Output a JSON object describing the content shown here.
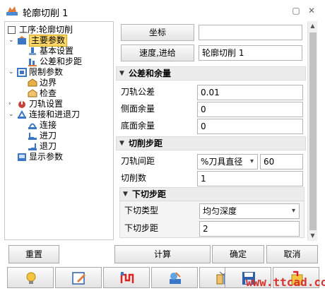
{
  "window": {
    "title": "轮廓切削 1"
  },
  "tree": {
    "items": [
      {
        "label": "工序:轮廓切削"
      },
      {
        "label": "主要参数"
      },
      {
        "label": "基本设置"
      },
      {
        "label": "公差和步距"
      },
      {
        "label": "限制参数"
      },
      {
        "label": "边界"
      },
      {
        "label": "检查"
      },
      {
        "label": "刀轨设置"
      },
      {
        "label": "连接和进退刀"
      },
      {
        "label": "连接"
      },
      {
        "label": "进刀"
      },
      {
        "label": "退刀"
      },
      {
        "label": "显示参数"
      }
    ]
  },
  "panel": {
    "coord_button": "坐标",
    "coord_value": "",
    "feed_button": "速度,进给",
    "feed_value": "轮廓切削 1",
    "tolerance_section": {
      "title": "公差和余量",
      "fields": [
        {
          "label": "刀轨公差",
          "value": "0.01"
        },
        {
          "label": "侧面余量",
          "value": "0"
        },
        {
          "label": "底面余量",
          "value": "0"
        }
      ]
    },
    "stepover_section": {
      "title": "切削步距",
      "spacing_label": "刀轨间距",
      "spacing_mode": "%刀具直径",
      "spacing_value": "60",
      "count_label": "切削数",
      "count_value": "1"
    },
    "stepdown_section": {
      "title": "下切步距",
      "type_label": "下切类型",
      "type_value": "均匀深度",
      "step_label": "下切步距",
      "step_value": "2"
    }
  },
  "buttons": {
    "reset": "重置",
    "calculate": "计算",
    "ok": "确定",
    "cancel": "取消"
  },
  "watermark": "www.ttcad.com"
}
